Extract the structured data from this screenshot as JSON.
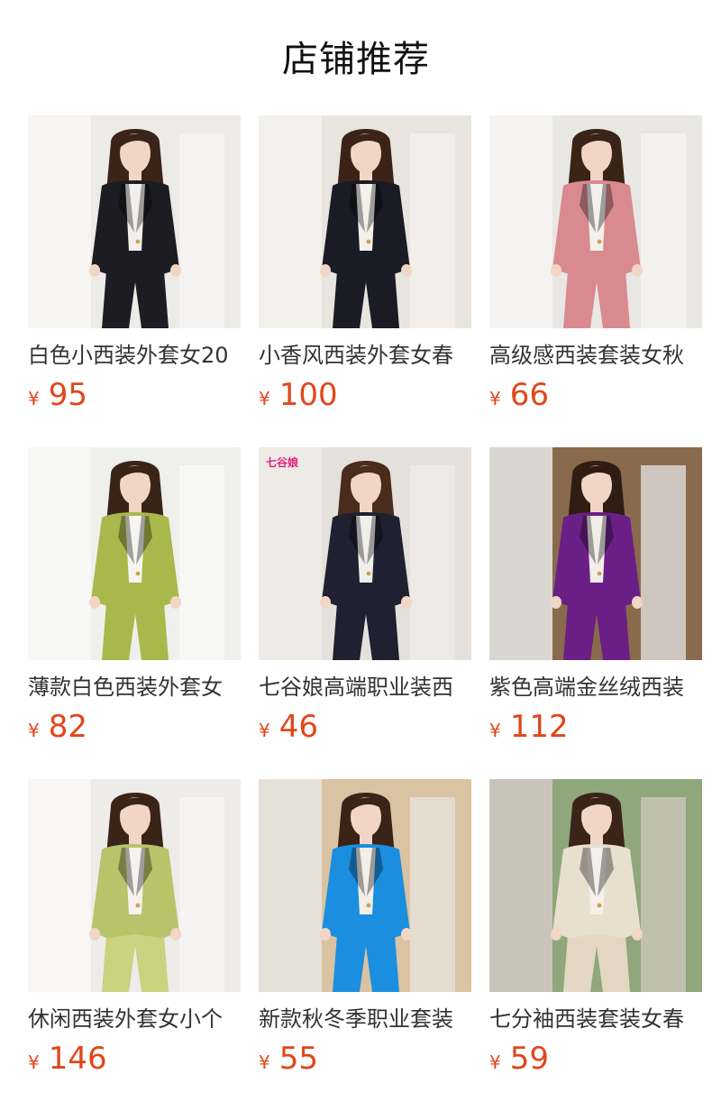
{
  "page": {
    "title": "店铺推荐"
  },
  "currency_symbol": "¥",
  "products": [
    {
      "name": "白色小西装外套女20",
      "price": "95",
      "image": "woman-black-blazer-white-top",
      "colors": {
        "bg": "#ecebe8",
        "wall": "#f6f5f2",
        "jacket": "#1c1c22",
        "inner": "#f2f0ec",
        "pants": "#1c1c22",
        "hair": "#3a2418"
      }
    },
    {
      "name": "小香风西装外套女春",
      "price": "100",
      "image": "woman-black-blazer-white-lapel",
      "colors": {
        "bg": "#e8e5df",
        "wall": "#f3f1ec",
        "jacket": "#1a1b24",
        "inner": "#f4f1ea",
        "pants": "#1a1b24",
        "hair": "#3b2417"
      }
    },
    {
      "name": "高级感西装套装女秋",
      "price": "66",
      "image": "woman-pink-plaid-suit",
      "colors": {
        "bg": "#e9e7e4",
        "wall": "#f4f3f1",
        "jacket": "#d98a8f",
        "inner": "#f3f0ee",
        "pants": "#d98a8f",
        "hair": "#3a2418"
      }
    },
    {
      "name": "薄款白色西装外套女",
      "price": "82",
      "image": "woman-lime-green-suit",
      "colors": {
        "bg": "#efefec",
        "wall": "#f8f8f6",
        "jacket": "#a9b84a",
        "inner": "#f5f4f0",
        "pants": "#a9b84a",
        "hair": "#3a2418"
      }
    },
    {
      "name": "七谷娘高端职业装西",
      "price": "46",
      "image": "two-women-dark-suits",
      "brand": "七谷娘",
      "colors": {
        "bg": "#e4e0db",
        "wall": "#eeeae5",
        "jacket": "#1f2030",
        "inner": "#f1efeb",
        "pants": "#1f2030",
        "hair": "#4a2c1c"
      }
    },
    {
      "name": "紫色高端金丝绒西装",
      "price": "112",
      "image": "woman-purple-velvet-suit",
      "colors": {
        "bg": "#8a6a4c",
        "wall": "#d9d6d2",
        "jacket": "#6a1f86",
        "inner": "#f1ede9",
        "pants": "#6a1f86",
        "hair": "#2f1c12"
      }
    },
    {
      "name": "休闲西装外套女小个",
      "price": "146",
      "image": "woman-lime-blazer-cream-bag",
      "colors": {
        "bg": "#eeece8",
        "wall": "#f7f6f3",
        "jacket": "#b7c46a",
        "inner": "#f5f3ef",
        "pants": "#c9d27e",
        "hair": "#3a2418"
      }
    },
    {
      "name": "新款秋冬季职业套装",
      "price": "55",
      "image": "woman-blue-suit",
      "colors": {
        "bg": "#d9c3a3",
        "wall": "#e6e1d8",
        "jacket": "#1b8ee0",
        "inner": "#f2eee8",
        "pants": "#1b8ee0",
        "hair": "#3a2418"
      }
    },
    {
      "name": "七分袖西装套装女春",
      "price": "59",
      "image": "woman-beige-suit-outdoor",
      "colors": {
        "bg": "#8fa77a",
        "wall": "#c9c4b9",
        "jacket": "#e8dfcf",
        "inner": "#f4efe8",
        "pants": "#e3d7c4",
        "hair": "#3a2418"
      }
    }
  ]
}
